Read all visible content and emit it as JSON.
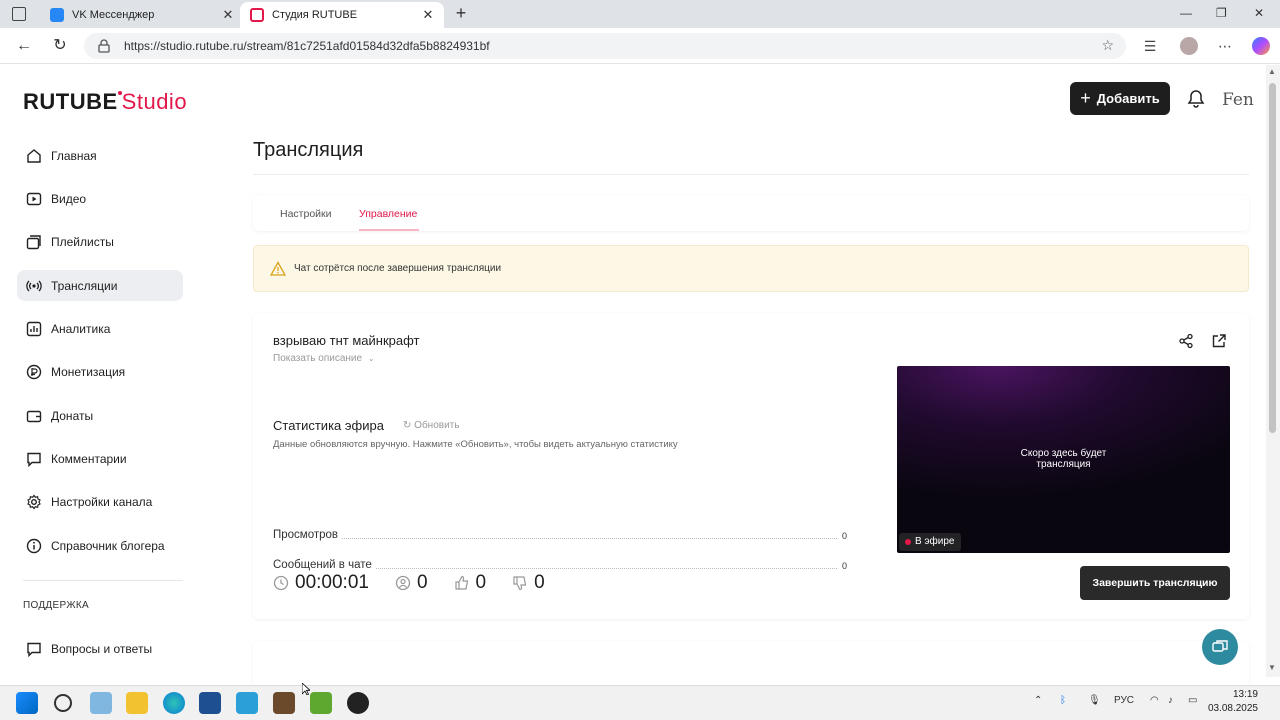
{
  "browser": {
    "tabs": [
      {
        "title": "VK Мессенджер",
        "favicon_color": "#2787f5"
      },
      {
        "title": "Студия RUTUBE",
        "favicon_color": "#e2174a"
      }
    ],
    "url": "https://studio.rutube.ru/stream/81c7251afd01584d32dfa5b8824931bf"
  },
  "header": {
    "logo_main": "RUTUBE",
    "logo_studio": "Studio",
    "add_button": "Добавить",
    "avatar_text": "Fen"
  },
  "sidebar": {
    "items": [
      {
        "label": "Главная",
        "icon": "home-icon"
      },
      {
        "label": "Видео",
        "icon": "video-icon"
      },
      {
        "label": "Плейлисты",
        "icon": "playlist-icon"
      },
      {
        "label": "Трансляции",
        "icon": "broadcast-icon",
        "active": true
      },
      {
        "label": "Аналитика",
        "icon": "analytics-icon"
      },
      {
        "label": "Монетизация",
        "icon": "monetization-icon"
      },
      {
        "label": "Донаты",
        "icon": "wallet-icon"
      },
      {
        "label": "Комментарии",
        "icon": "comment-icon"
      },
      {
        "label": "Настройки канала",
        "icon": "gear-icon"
      },
      {
        "label": "Справочник блогера",
        "icon": "info-icon"
      }
    ],
    "support_heading": "ПОДДЕРЖКА",
    "support_items": [
      {
        "label": "Вопросы и ответы",
        "icon": "help-icon"
      }
    ]
  },
  "main": {
    "title": "Трансляция",
    "tabs": [
      {
        "label": "Настройки"
      },
      {
        "label": "Управление",
        "active": true
      }
    ],
    "warning": "Чат сотрётся после завершения трансляции",
    "stream": {
      "name": "взрываю тнт майнкрафт",
      "show_description": "Показать описание"
    },
    "stats": {
      "title": "Статистика эфира",
      "refresh": "Обновить",
      "note": "Данные обновляются вручную. Нажмите «Обновить», чтобы видеть актуальную статистику",
      "rows": [
        {
          "label": "Просмотров",
          "value": "0"
        },
        {
          "label": "Сообщений в чате",
          "value": "0"
        }
      ]
    },
    "counters": {
      "duration": "00:00:01",
      "viewers": "0",
      "likes": "0",
      "dislikes": "0"
    },
    "player": {
      "placeholder_line1": "Скоро здесь будет",
      "placeholder_line2": "трансляция",
      "live_badge": "В эфире"
    },
    "end_button": "Завершить трансляцию"
  },
  "taskbar": {
    "language": "РУС",
    "time": "13:19",
    "date": "03.08.2025"
  },
  "colors": {
    "accent": "#e2174a",
    "dark_button": "#1e1e1e",
    "warning_bg": "#fdf8e6",
    "support_button": "#2e8a9e"
  }
}
